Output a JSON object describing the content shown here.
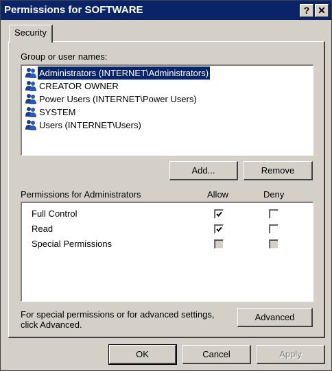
{
  "window": {
    "title": "Permissions for SOFTWARE",
    "help_label": "?",
    "close_label": "✕"
  },
  "tabs": [
    {
      "label": "Security"
    }
  ],
  "groups": {
    "label": "Group or user names:",
    "items": [
      {
        "name": "Administrators (INTERNET\\Administrators)",
        "icon": "user-group-icon"
      },
      {
        "name": "CREATOR OWNER",
        "icon": "user-group-icon"
      },
      {
        "name": "Power Users (INTERNET\\Power Users)",
        "icon": "user-group-icon"
      },
      {
        "name": "SYSTEM",
        "icon": "user-group-icon"
      },
      {
        "name": "Users (INTERNET\\Users)",
        "icon": "user-group-icon"
      }
    ],
    "selected": "Administrators (INTERNET\\Administrators)"
  },
  "buttons": {
    "add": "Add...",
    "remove": "Remove",
    "advanced": "Advanced",
    "ok": "OK",
    "cancel": "Cancel",
    "apply": "Apply"
  },
  "permissions": {
    "label": "Permissions for Administrators",
    "allow_header": "Allow",
    "deny_header": "Deny",
    "rows": [
      {
        "name": "Full Control",
        "allow": "checked",
        "deny": "unchecked"
      },
      {
        "name": "Read",
        "allow": "checked",
        "deny": "unchecked"
      },
      {
        "name": "Special Permissions",
        "allow": "disabled",
        "deny": "disabled"
      }
    ]
  },
  "advanced_text": {
    "line1": "For special permissions or for advanced settings,",
    "line2": "click Advanced."
  },
  "colors": {
    "title_bar": "#0a246a",
    "face": "#d4d0c8",
    "selection": "#0a246a"
  }
}
